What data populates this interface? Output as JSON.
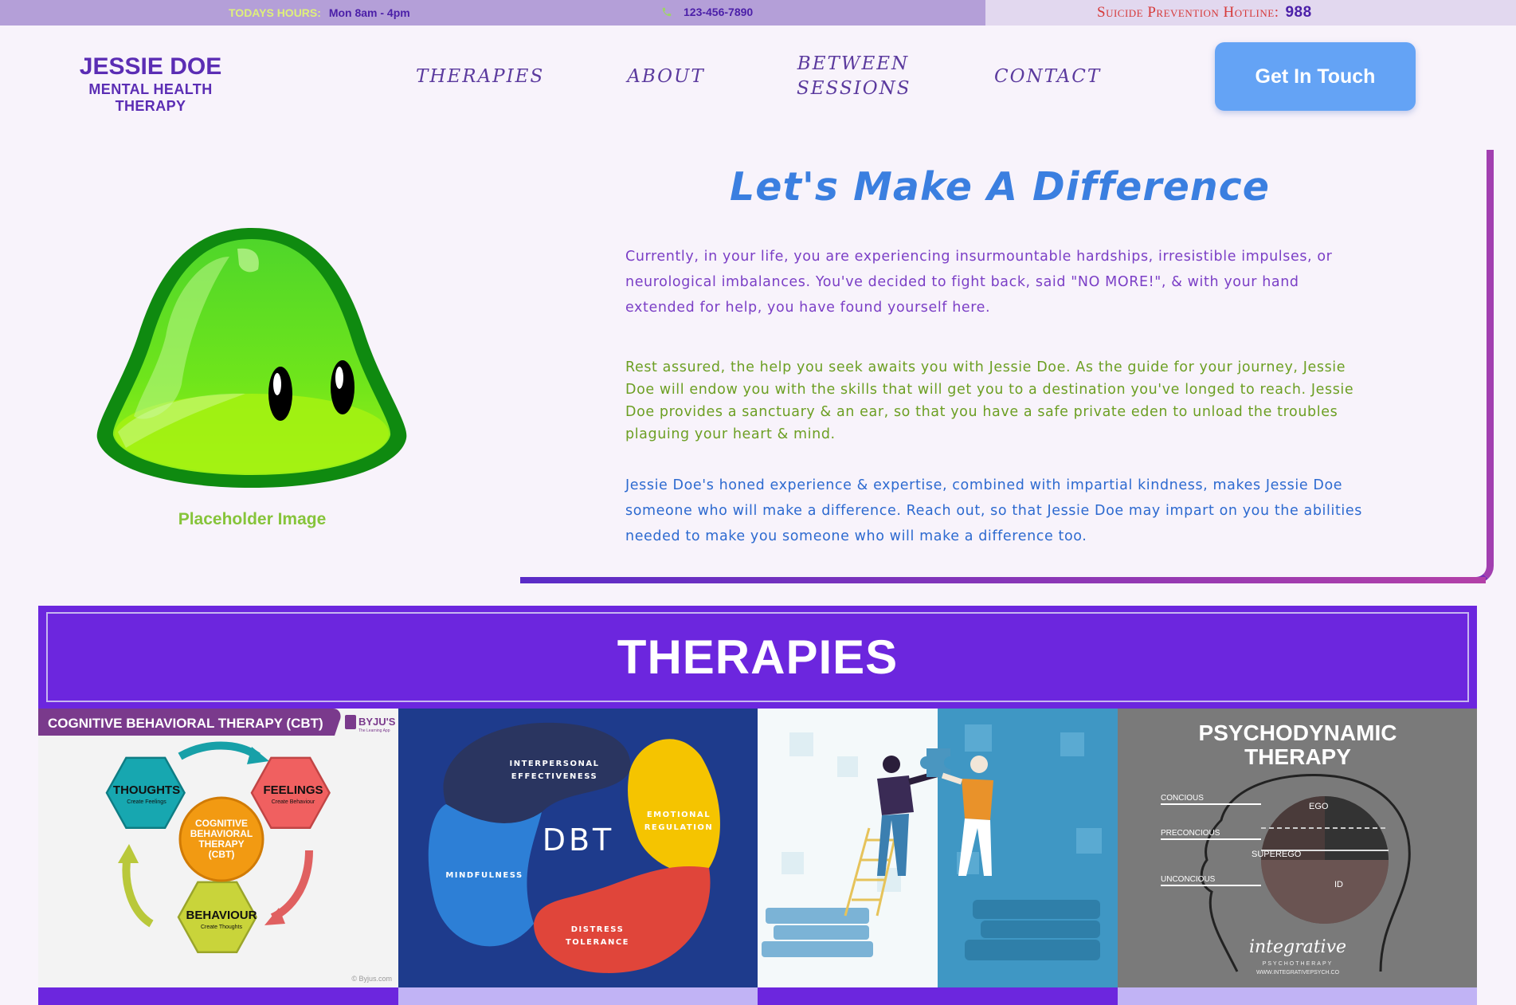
{
  "topbar": {
    "hours_label": "TODAYS HOURS:",
    "hours_value": "Mon 8am - 4pm",
    "phone": "123-456-7890",
    "hotline_label": "Suicide Prevention Hotline:",
    "hotline_number": "988"
  },
  "header": {
    "brand_name": "JESSIE DOE",
    "brand_tagline": "MENTAL HEALTH THERAPY",
    "nav": [
      {
        "label": "THERAPIES"
      },
      {
        "label": "ABOUT"
      },
      {
        "label": "BETWEEN SESSIONS",
        "line1": "BETWEEN",
        "line2": "SESSIONS"
      },
      {
        "label": "CONTACT"
      }
    ],
    "cta_label": "Get In Touch"
  },
  "hero": {
    "image_caption": "Placeholder Image",
    "title": "Let's Make A Difference",
    "paragraphs": [
      "Currently, in your life, you are experiencing insurmountable hardships, irresistible impulses, or neurological imbalances. You've decided to fight back, said \"NO MORE!\", & with your hand extended for help, you have found yourself here.",
      "Rest assured, the help you seek awaits you with Jessie Doe. As the guide for your journey, Jessie Doe will endow you with the skills that will get you to a destination you've longed to reach. Jessie Doe provides a sanctuary & an ear, so that you have a safe private eden to unload the troubles plaguing your heart & mind.",
      "Jessie Doe's honed experience & expertise, combined with impartial kindness, makes Jessie Doe someone who will make a difference. Reach out, so that Jessie Doe may impart on you the abilities needed to make you someone who will make a difference too."
    ]
  },
  "therapies": {
    "title": "THERAPIES",
    "cards": [
      {
        "name": "cbt",
        "header": "COGNITIVE BEHAVIORAL THERAPY (CBT)",
        "logo": "BYJU'S",
        "logo_sub": "The Learning App",
        "thoughts": "THOUGHTS",
        "thoughts_sub": "Create Feelings",
        "feelings": "FEELINGS",
        "feelings_sub": "Create Behaviour",
        "behaviour": "BEHAVIOUR",
        "behaviour_sub": "Create Thoughts",
        "center_lines": [
          "COGNITIVE",
          "BEHAVIORAL",
          "THERAPY",
          "(CBT)"
        ],
        "credit": "© Byjus.com"
      },
      {
        "name": "dbt",
        "center": "DBT",
        "segments": [
          {
            "lines": [
              "INTERPERSONAL",
              "EFFECTIVENESS"
            ]
          },
          {
            "lines": [
              "EMOTIONAL",
              "REGULATION"
            ]
          },
          {
            "lines": [
              "DISTRESS",
              "TOLERANCE"
            ]
          },
          {
            "lines": [
              "MINDFULNESS"
            ]
          }
        ]
      },
      {
        "name": "puzzle-illustration"
      },
      {
        "name": "psychodynamic",
        "title_lines": [
          "PSYCHODYNAMIC",
          "THERAPY"
        ],
        "levels": [
          "CONCIOUS",
          "PRECONCIOUS",
          "UNCONCIOUS"
        ],
        "parts": [
          "EGO",
          "SUPEREGO",
          "ID"
        ],
        "signature": "integrative",
        "sub": "PSYCHOTHERAPY",
        "site": "WWW.INTEGRATIVEPSYCH.CO"
      }
    ]
  },
  "colors": {
    "topbar_left": "#b49fd8",
    "topbar_right": "#e2d8ef",
    "brand": "#5b2db4",
    "cta": "#64a3f5",
    "title_blue": "#3b7fe0",
    "para1": "#7b3fc6",
    "para2": "#6c9f23",
    "para3": "#2d6ad0",
    "therapies_band": "#6c26de",
    "strip_dark": "#6c26de",
    "strip_light": "#c1b3f5"
  }
}
